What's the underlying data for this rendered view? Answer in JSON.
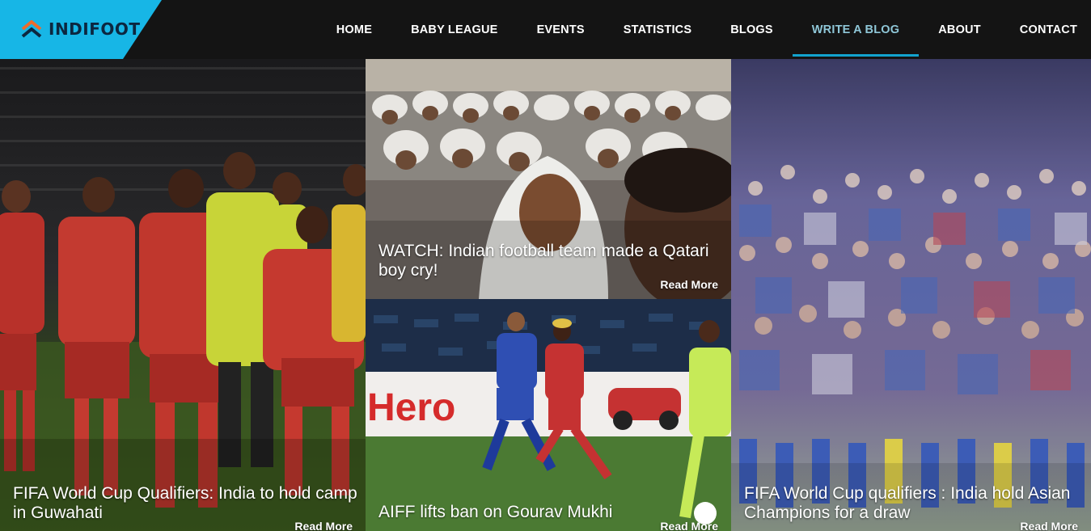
{
  "brand": {
    "name": "INDIFOOT",
    "logo_icon": "chevron-stack-icon",
    "colors": {
      "logo_bg": "#17b6e6",
      "logo_text": "#0c2740",
      "mark_orange": "#ef6b2a",
      "mark_navy": "#0c2740"
    }
  },
  "nav": {
    "items": [
      {
        "label": "HOME"
      },
      {
        "label": "BABY LEAGUE"
      },
      {
        "label": "EVENTS"
      },
      {
        "label": "STATISTICS"
      },
      {
        "label": "BLOGS"
      },
      {
        "label": "WRITE A BLOG",
        "active": true
      },
      {
        "label": "ABOUT"
      },
      {
        "label": "CONTACT"
      }
    ],
    "colors": {
      "bg": "#141414",
      "text": "#ffffff",
      "active_text": "#8fc7d8",
      "active_underline": "#12a3cf"
    }
  },
  "posts": [
    {
      "title": "FIFA World Cup Qualifiers: India to hold camp in Guwahati",
      "read_more": "Read More",
      "image": "india-team-training-photo"
    },
    {
      "title": "WATCH: Indian football team made a Qatari boy cry!",
      "read_more": "Read More",
      "image": "qatari-crowd-photo"
    },
    {
      "title": "AIFF lifts ban on Gourav Mukhi",
      "read_more": "Read More",
      "image": "isl-match-action-photo"
    },
    {
      "title": "FIFA World Cup qualifiers : India hold Asian Champions for a draw",
      "read_more": "Read More",
      "image": "fans-celebrating-photo"
    }
  ]
}
